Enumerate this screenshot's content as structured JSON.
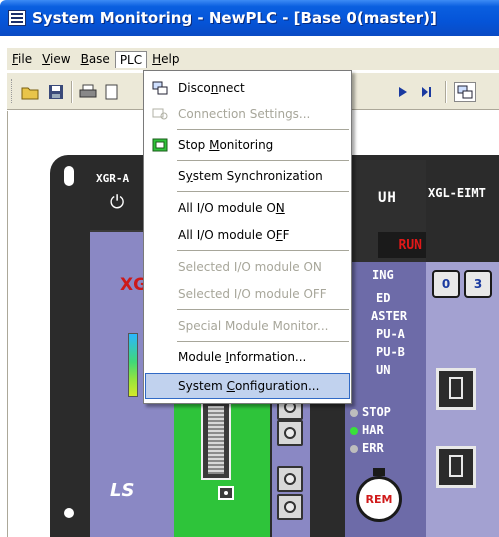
{
  "window": {
    "title": "System Monitoring - NewPLC - [Base 0(master)]"
  },
  "menubar": {
    "items": [
      {
        "label": "File"
      },
      {
        "label": "View"
      },
      {
        "label": "Base"
      },
      {
        "label": "PLC"
      },
      {
        "label": "Help"
      }
    ]
  },
  "toolbar": {
    "icons": [
      "open-icon",
      "save-icon",
      "print-icon",
      "preview-icon",
      "play-icon",
      "step-icon",
      "connect-icon"
    ]
  },
  "plc_menu": {
    "items": [
      {
        "label": "Disconnect",
        "enabled": true,
        "icon": "connect-icon"
      },
      {
        "label": "Connection Settings...",
        "enabled": false,
        "icon": "connection-settings-icon"
      },
      {
        "label": "Stop Monitoring",
        "enabled": true,
        "icon": "monitor-icon"
      },
      {
        "label": "System Synchronization",
        "enabled": true
      },
      {
        "label": "All I/O module ON",
        "enabled": true
      },
      {
        "label": "All I/O module OFF",
        "enabled": true
      },
      {
        "label": "Selected I/O module ON",
        "enabled": false
      },
      {
        "label": "Selected I/O module OFF",
        "enabled": false
      },
      {
        "label": "Special Module Monitor...",
        "enabled": false
      },
      {
        "label": "Module Information...",
        "enabled": true
      },
      {
        "label": "System Configuration...",
        "enabled": true,
        "highlighted": true
      }
    ]
  },
  "rack": {
    "power_module": {
      "model": "XGR-A",
      "brand_top": "XG",
      "brand_bottom": "LS"
    },
    "cpu_module": {
      "header": "UH",
      "run_label": "RUN",
      "status_labels": [
        "ING",
        "ED",
        "ASTER",
        "PU-A",
        "PU-B",
        "UN",
        "STOP",
        "HAR",
        "ERR"
      ],
      "rem_label": "REM"
    },
    "comm_module": {
      "model": "XGL-EIMT",
      "dial_a": "0",
      "dial_b": "3"
    }
  },
  "colors": {
    "titlebar": "#0554d8",
    "menu_highlight": "#c1d2ee",
    "module_purple": "#8a88c4",
    "module_green": "#2ec43a",
    "led_red": "#e01818"
  }
}
